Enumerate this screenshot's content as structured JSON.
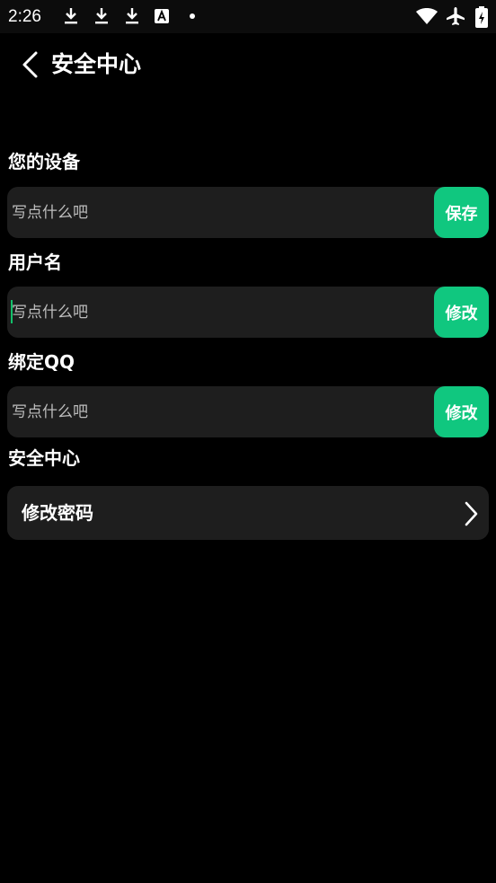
{
  "status_bar": {
    "time": "2:26",
    "icons": [
      "download-icon",
      "download-icon",
      "download-icon",
      "a-icon",
      "dot-icon",
      "wifi-icon",
      "airplane-icon",
      "battery-icon"
    ]
  },
  "header": {
    "title": "安全中心"
  },
  "sections": [
    {
      "label": "您的设备",
      "placeholder": "写点什么吧",
      "button": "保存"
    },
    {
      "label": "用户名",
      "placeholder": "写点什么吧",
      "button": "修改"
    },
    {
      "label": "绑定QQ",
      "placeholder": "写点什么吧",
      "button": "修改"
    }
  ],
  "security": {
    "label": "安全中心",
    "item_label": "修改密码"
  },
  "colors": {
    "accent": "#10c77f",
    "background": "#000000",
    "field": "#1e1e1e"
  }
}
